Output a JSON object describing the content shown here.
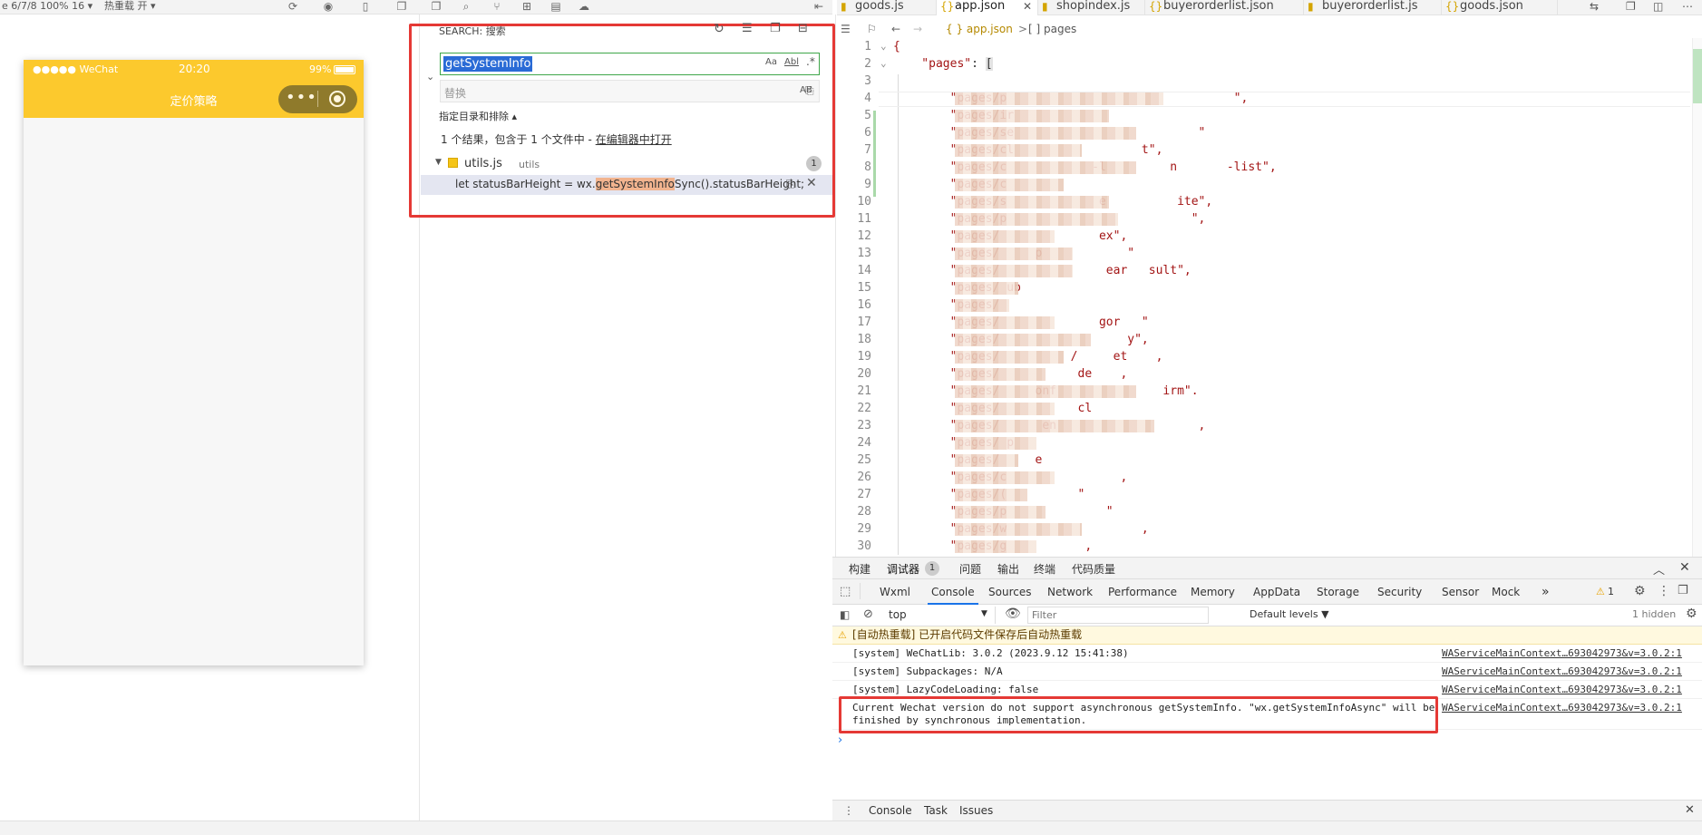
{
  "toolbar": {
    "device": "e 6/7/8 100% 16 ▾",
    "hotreload": "热重载 开 ▾"
  },
  "simulator": {
    "carrier": "●●●●● WeChat",
    "time": "20:20",
    "battery": "99%",
    "nav_title": "定价策略"
  },
  "search": {
    "header": "SEARCH: 搜索",
    "query": "getSystemInfo",
    "match_case": "Aa",
    "whole_word": "Abl",
    "regex": ".*",
    "replace_placeholder": "替换",
    "preserve_case": "AB",
    "include_exclude": "指定目录和排除 ▴",
    "summary": "1 个结果，包含于 1 个文件中 - ",
    "open_in_editor": "在编辑器中打开",
    "file_name": "utils.js",
    "file_dir": "utils",
    "file_count": "1",
    "match_prefix": "let statusBarHeight = wx.",
    "match_hit": "getSystemInfo",
    "match_suffix": "Sync().statusBarHeight;"
  },
  "editor": {
    "tabs": [
      {
        "label": "goods.js"
      },
      {
        "label": "app.json"
      },
      {
        "label": "shopindex.js"
      },
      {
        "label": "buyerorderlist.json"
      },
      {
        "label": "buyerorderlist.js"
      },
      {
        "label": "goods.json"
      }
    ],
    "breadcrumb_file": "{ } app.json",
    "breadcrumb_sep": ">",
    "breadcrumb_key": "[ ] pages",
    "line_numbers": [
      "1",
      "2",
      "3",
      "4",
      "5",
      "6",
      "7",
      "8",
      "9",
      "10",
      "11",
      "12",
      "13",
      "14",
      "15",
      "16",
      "17",
      "18",
      "19",
      "20",
      "21",
      "22",
      "23",
      "24",
      "25",
      "26",
      "27",
      "28",
      "29",
      "30"
    ],
    "code": {
      "l1": "{",
      "l2": "    \"pages\": [",
      "l4": "        \"pages/p                                \",",
      "l5": "        \"pages/ir",
      "l6": "        \"pages/se                          \"",
      "l7": "        \"pages/cl                  t\",",
      "l8": "        \"pages/c            -l         n       -list\",",
      "l9": "        \"pages/c",
      "l10": "        \"pages/s             e          ite\",",
      "l11": "        \"pages/p                          \",",
      "l12": "        \"pages/              ex\",",
      "l13": "        \"pages/     p            \"",
      "l14": "        \"pages/               ear   sult\",",
      "l15": "        \"pages/ ub",
      "l16": "        \"pages/",
      "l17": "        \"pages/              gor   \"",
      "l18": "        \"pages/                  y\",",
      "l19": "        \"pages/          /     et    ,",
      "l20": "        \"pages/           de    ,",
      "l21": "        \"pages/     onf               irm\".",
      "l22": "        \"pages/           cl",
      "l23": "        \"pages/      en                    ,",
      "l24": "        \"pages/ p",
      "l25": "        \"pages/     e",
      "l26": "        \"pages/c                ,",
      "l27": "        \"pages/(          \"",
      "l28": "        \"pages/p              \"",
      "l29": "        \"pages/w                   ,",
      "l30": "        \"pages/g           ,"
    }
  },
  "devtools": {
    "top_tabs": {
      "build": "构建",
      "debugger": "调试器",
      "debugger_badge": "1",
      "issues": "问题",
      "output": "输出",
      "terminal": "终端",
      "quality": "代码质量"
    },
    "tabs": [
      "Wxml",
      "Console",
      "Sources",
      "Network",
      "Performance",
      "Memory",
      "AppData",
      "Storage",
      "Security",
      "Sensor",
      "Mock"
    ],
    "more": "»",
    "warn_count": "1",
    "context": "top",
    "filter_placeholder": "Filter",
    "levels": "Default levels ▼",
    "hidden": "1 hidden",
    "warning": "[自动热重载] 已开启代码文件保存后自动热重载",
    "logs": [
      {
        "msg": "[system] WeChatLib: 3.0.2 (2023.9.12 15:41:38)",
        "src": "WAServiceMainContext…693042973&v=3.0.2:1"
      },
      {
        "msg": "[system] Subpackages: N/A",
        "src": "WAServiceMainContext…693042973&v=3.0.2:1"
      },
      {
        "msg": "[system] LazyCodeLoading: false",
        "src": "WAServiceMainContext…693042973&v=3.0.2:1"
      }
    ],
    "highlight_line1": "Current Wechat version do not support asynchronous getSystemInfo. \"wx.getSystemInfoAsync\" will be",
    "highlight_line2": "finished by synchronous implementation.",
    "highlight_src": "WAServiceMainContext…693042973&v=3.0.2:1",
    "prompt": "›",
    "drawer": {
      "console": "Console",
      "task": "Task",
      "issues": "Issues"
    }
  }
}
